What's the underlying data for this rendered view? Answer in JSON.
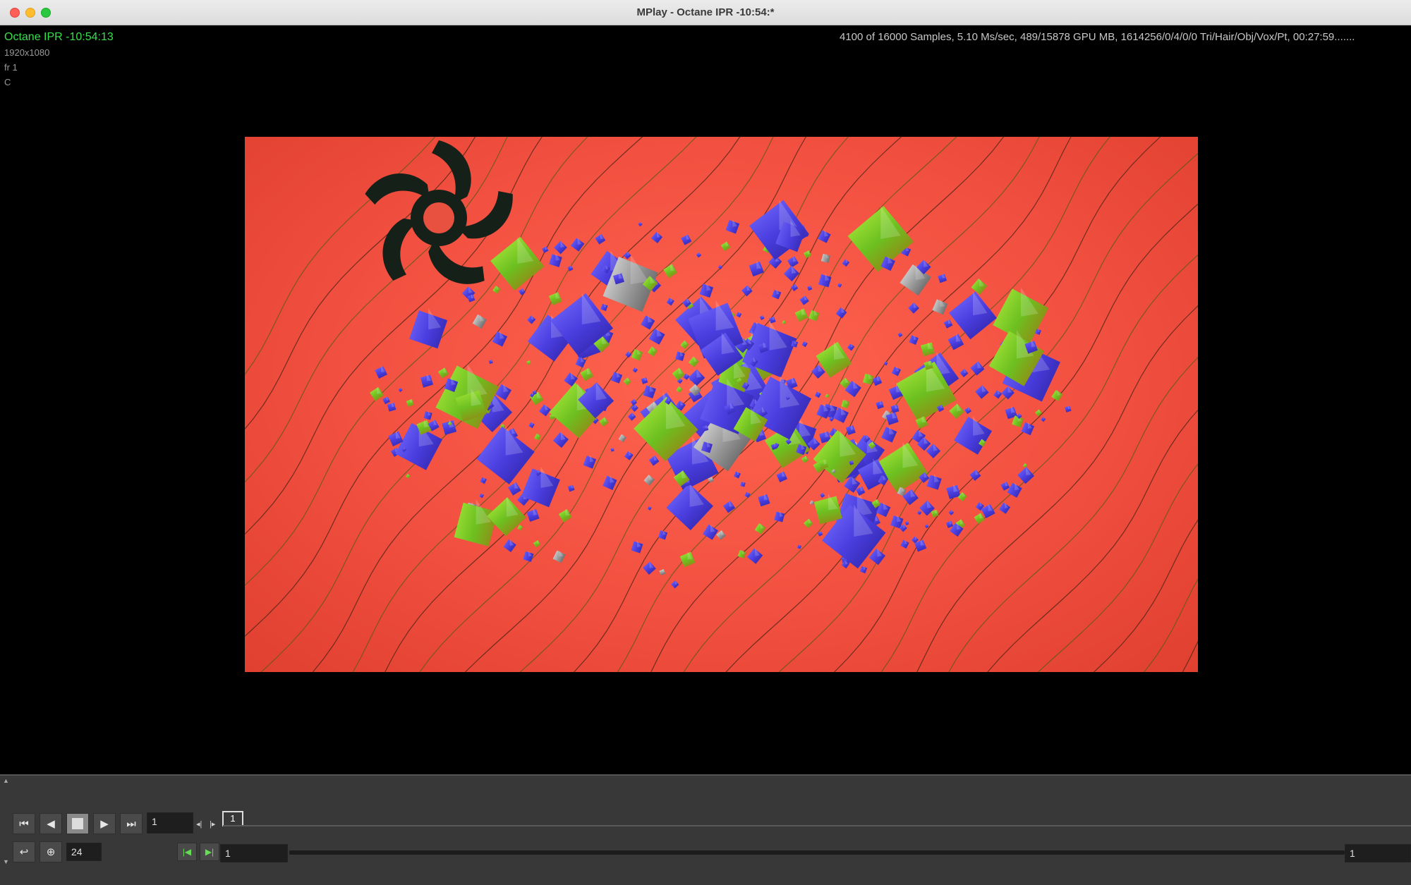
{
  "window": {
    "title": "MPlay - Octane IPR -10:54:*"
  },
  "hud": {
    "render_name": "Octane IPR -10:54:13",
    "resolution": "1920x1080",
    "frame": "fr 1",
    "channel": "C",
    "stats": "4100 of 16000 Samples, 5.10 Ms/sec, 489/15878 GPU MB, 1614256/0/4/0/0 Tri/Hair/Obj/Vox/Pt, 00:27:59......."
  },
  "playbar": {
    "current_frame": "1",
    "frame_marker": "1",
    "fps": "24",
    "range_start": "1",
    "range_end": "1"
  },
  "colors": {
    "render_background": "#f25040",
    "hud_title": "#38e04a",
    "crystal_blue": "#4a3ee0",
    "crystal_green": "#6cc020"
  }
}
